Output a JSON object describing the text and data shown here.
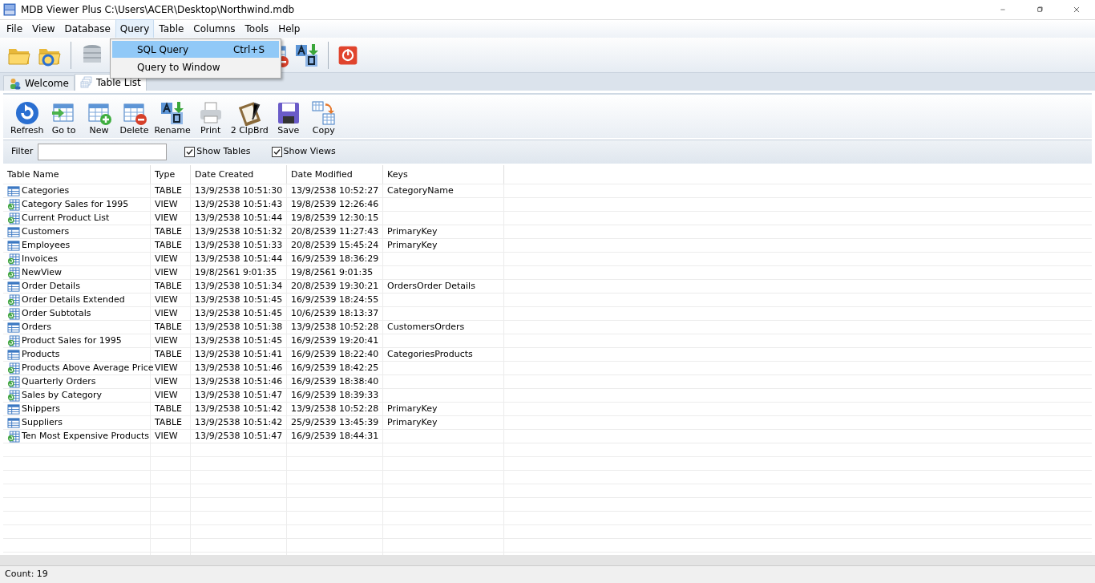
{
  "window": {
    "title": "MDB Viewer Plus C:\\Users\\ACER\\Desktop\\Northwind.mdb"
  },
  "menu": [
    {
      "label": "File",
      "open": false
    },
    {
      "label": "View",
      "open": false
    },
    {
      "label": "Database",
      "open": false
    },
    {
      "label": "Query",
      "open": true
    },
    {
      "label": "Table",
      "open": false
    },
    {
      "label": "Columns",
      "open": false
    },
    {
      "label": "Tools",
      "open": false
    },
    {
      "label": "Help",
      "open": false
    }
  ],
  "dropdown": [
    {
      "label": "SQL Query",
      "shortcut": "Ctrl+S",
      "selected": true
    },
    {
      "label": "Query to Window",
      "selected": false
    }
  ],
  "tabs": [
    {
      "label": "Welcome",
      "selected": false
    },
    {
      "label": "Table List",
      "selected": true
    }
  ],
  "table_toolbar": [
    "Refresh",
    "Go to",
    "New",
    "Delete",
    "Rename",
    "Print",
    "2 ClpBrd",
    "Save",
    "Copy"
  ],
  "filter": {
    "label": "Filter"
  },
  "options": [
    {
      "label": "Show Tables",
      "checked": true
    },
    {
      "label": "Show Views",
      "checked": true
    }
  ],
  "table": {
    "columns": [
      "Table Name",
      "Type",
      "Date Created",
      "Date Modified",
      "Keys"
    ],
    "rows": [
      {
        "kind": "table",
        "cells": [
          "Categories",
          "TABLE",
          "13/9/2538 10:51:30",
          "13/9/2538 10:52:27",
          "CategoryName"
        ]
      },
      {
        "kind": "view",
        "cells": [
          "Category Sales for 1995",
          "VIEW",
          "13/9/2538 10:51:43",
          "19/8/2539 12:26:46",
          ""
        ]
      },
      {
        "kind": "view",
        "cells": [
          "Current Product List",
          "VIEW",
          "13/9/2538 10:51:44",
          "19/8/2539 12:30:15",
          ""
        ]
      },
      {
        "kind": "table",
        "cells": [
          "Customers",
          "TABLE",
          "13/9/2538 10:51:32",
          "20/8/2539 11:27:43",
          "PrimaryKey"
        ]
      },
      {
        "kind": "table",
        "cells": [
          "Employees",
          "TABLE",
          "13/9/2538 10:51:33",
          "20/8/2539 15:45:24",
          "PrimaryKey"
        ]
      },
      {
        "kind": "view",
        "cells": [
          "Invoices",
          "VIEW",
          "13/9/2538 10:51:44",
          "16/9/2539 18:36:29",
          ""
        ]
      },
      {
        "kind": "view",
        "cells": [
          "NewView",
          "VIEW",
          "19/8/2561 9:01:35",
          "19/8/2561 9:01:35",
          ""
        ]
      },
      {
        "kind": "table",
        "cells": [
          "Order Details",
          "TABLE",
          "13/9/2538 10:51:34",
          "20/8/2539 19:30:21",
          "OrdersOrder Details"
        ]
      },
      {
        "kind": "view",
        "cells": [
          "Order Details Extended",
          "VIEW",
          "13/9/2538 10:51:45",
          "16/9/2539 18:24:55",
          ""
        ]
      },
      {
        "kind": "view",
        "cells": [
          "Order Subtotals",
          "VIEW",
          "13/9/2538 10:51:45",
          "10/6/2539 18:13:37",
          ""
        ]
      },
      {
        "kind": "table",
        "cells": [
          "Orders",
          "TABLE",
          "13/9/2538 10:51:38",
          "13/9/2538 10:52:28",
          "CustomersOrders"
        ]
      },
      {
        "kind": "view",
        "cells": [
          "Product Sales for 1995",
          "VIEW",
          "13/9/2538 10:51:45",
          "16/9/2539 19:20:41",
          ""
        ]
      },
      {
        "kind": "table",
        "cells": [
          "Products",
          "TABLE",
          "13/9/2538 10:51:41",
          "16/9/2539 18:22:40",
          "CategoriesProducts"
        ]
      },
      {
        "kind": "view",
        "cells": [
          "Products Above Average Price",
          "VIEW",
          "13/9/2538 10:51:46",
          "16/9/2539 18:42:25",
          ""
        ]
      },
      {
        "kind": "view",
        "cells": [
          "Quarterly Orders",
          "VIEW",
          "13/9/2538 10:51:46",
          "16/9/2539 18:38:40",
          ""
        ]
      },
      {
        "kind": "view",
        "cells": [
          "Sales by Category",
          "VIEW",
          "13/9/2538 10:51:47",
          "16/9/2539 18:39:33",
          ""
        ]
      },
      {
        "kind": "table",
        "cells": [
          "Shippers",
          "TABLE",
          "13/9/2538 10:51:42",
          "13/9/2538 10:52:28",
          "PrimaryKey"
        ]
      },
      {
        "kind": "table",
        "cells": [
          "Suppliers",
          "TABLE",
          "13/9/2538 10:51:42",
          "25/9/2539 13:45:39",
          "PrimaryKey"
        ]
      },
      {
        "kind": "view",
        "cells": [
          "Ten Most Expensive Products",
          "VIEW",
          "13/9/2538 10:51:47",
          "16/9/2539 18:44:31",
          ""
        ]
      }
    ]
  },
  "status_bar": "Count: 19"
}
